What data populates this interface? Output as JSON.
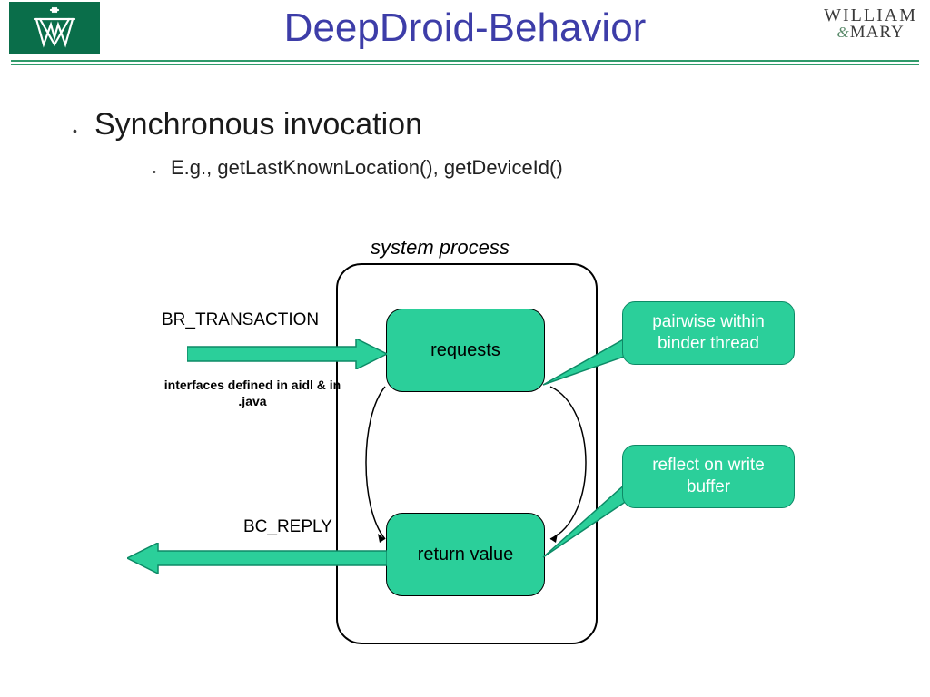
{
  "header": {
    "title": "DeepDroid-Behavior",
    "institution_line1": "WILLIAM",
    "institution_line2": "MARY",
    "institution_amp": "&"
  },
  "content": {
    "heading": "Synchronous invocation",
    "subheading": "E.g., getLastKnownLocation(), getDeviceId()"
  },
  "diagram": {
    "system_label": "system process",
    "node_requests": "requests",
    "node_return": "return value",
    "arrow_in_label": "BR_TRANSACTION",
    "arrow_out_label": "BC_REPLY",
    "aidl_note": "interfaces defined in aidl & in .java",
    "callout1": "pairwise within binder thread",
    "callout2": "reflect on write buffer"
  }
}
